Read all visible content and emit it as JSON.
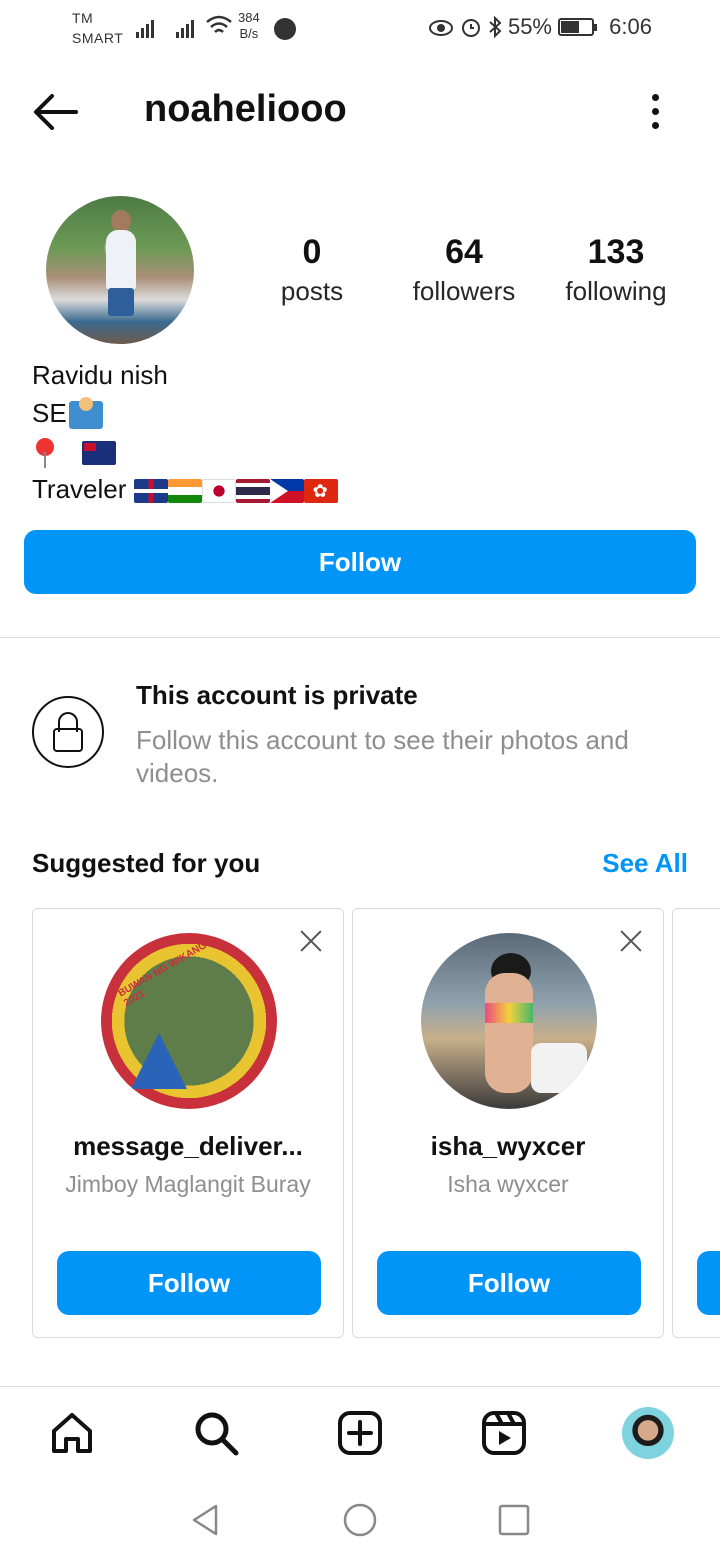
{
  "status_bar": {
    "carrier_line1": "TM",
    "carrier_line2": "SMART",
    "net_speed_value": "384",
    "net_speed_unit": "B/s",
    "battery": "55%",
    "battery_level": 0.55,
    "time": "6:06"
  },
  "header": {
    "username": "noaheliooo",
    "back_icon": "arrow-left-icon",
    "more_icon": "vertical-dots-icon"
  },
  "profile": {
    "stats": [
      {
        "num": "0",
        "label": "posts"
      },
      {
        "num": "64",
        "label": "followers"
      },
      {
        "num": "133",
        "label": "following"
      }
    ],
    "name": "Ravidu nish",
    "bio_line1": "SE",
    "bio_line3": "Traveler",
    "follow_label": "Follow"
  },
  "private": {
    "title": "This account is private",
    "subtitle": "Follow this account to see their photos and videos."
  },
  "suggested": {
    "title": "Suggested for you",
    "see_all": "See All",
    "cards": [
      {
        "username": "message_deliver...",
        "full_name": "Jimboy Maglangit Buray",
        "button": "Follow",
        "badge_text": "BUWAN NG WIKANG PAMBANSA 2021"
      },
      {
        "username": "isha_wyxcer",
        "full_name": "Isha wyxcer",
        "button": "Follow"
      }
    ]
  },
  "bottom_nav": {
    "items": [
      "home-icon",
      "search-icon",
      "new-post-icon",
      "reels-icon",
      "profile-avatar"
    ]
  },
  "colors": {
    "accent": "#0095f6",
    "text": "#262626",
    "secondary": "#8e8e8e",
    "border": "#dbdbdb"
  }
}
